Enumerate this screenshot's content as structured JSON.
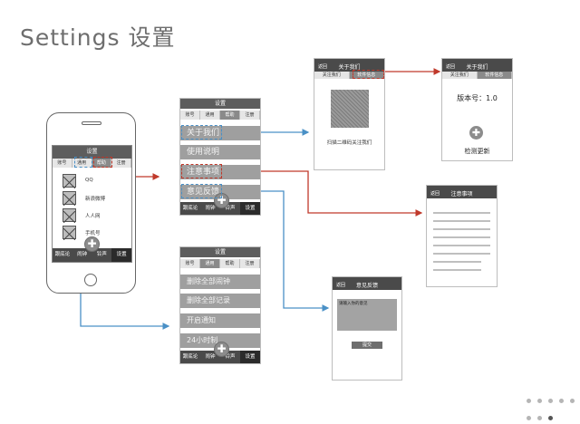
{
  "page_title": "Settings 设置",
  "phone": {
    "header": "设置",
    "tabs": [
      "账号",
      "通用",
      "帮助",
      "注册"
    ],
    "accounts": [
      "QQ",
      "新浪微博",
      "人人网",
      "手机号"
    ],
    "bottom_nav": [
      "跟底论",
      "闹钟",
      "铃声",
      "设置"
    ]
  },
  "help_screen": {
    "header": "设置",
    "tabs": [
      "账号",
      "通用",
      "帮助",
      "注册"
    ],
    "rows": [
      "关于我们",
      "使用说明",
      "注意事项",
      "意见反馈"
    ],
    "bottom_nav": [
      "跟底论",
      "闹钟",
      "铃声",
      "设置"
    ]
  },
  "general_screen": {
    "header": "设置",
    "tabs": [
      "账号",
      "通用",
      "帮助",
      "注册"
    ],
    "rows": [
      "删除全部闹钟",
      "删除全部记录",
      "开启通知",
      "24小时制"
    ],
    "bottom_nav": [
      "跟底论",
      "闹钟",
      "铃声",
      "设置"
    ]
  },
  "about_screen": {
    "back": "返回",
    "header": "关于我们",
    "tabs": [
      "关注我们",
      "软件信息"
    ],
    "caption": "扫描二维码关注我们"
  },
  "software_screen": {
    "back": "返回",
    "header": "关于我们",
    "tabs": [
      "关注我们",
      "软件信息"
    ],
    "version": "版本号：1.0",
    "check_update": "检测更新"
  },
  "notes_screen": {
    "back": "返回",
    "header": "注意事项"
  },
  "feedback_screen": {
    "back": "返回",
    "header": "意见反馈",
    "placeholder": "请输入你的意见",
    "submit": "提交"
  },
  "pager": {
    "count": 8,
    "active_index": 7
  },
  "colors": {
    "blue_link": "#4a90c6",
    "red_link": "#c0392b",
    "bar_dark": "#4a4a4a",
    "row_grey": "#9f9f9f"
  }
}
